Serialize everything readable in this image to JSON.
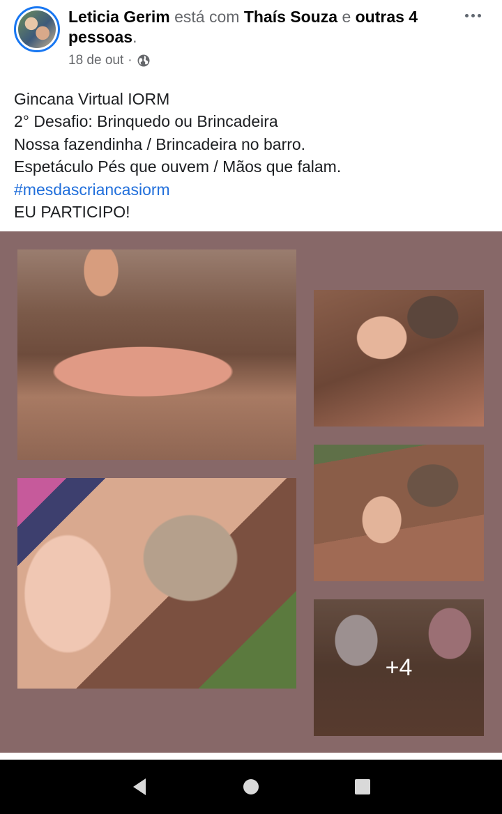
{
  "post": {
    "author": "Leticia Gerim",
    "with_text": "está com",
    "tagged": "Thaís Souza",
    "and_text": "e",
    "others": "outras 4 pessoas",
    "period": ".",
    "date": "18 de out",
    "separator": "·",
    "privacy_icon": "globe-icon",
    "text_lines": [
      "Gincana Virtual IORM",
      "2° Desafio: Brinquedo ou Brincadeira",
      "Nossa fazendinha / Brincadeira no barro.",
      "Espetáculo Pés que ouvem / Mãos que falam."
    ],
    "hashtag": "#mesdascriancasiorm",
    "closing": "EU PARTICIPO!"
  },
  "gallery": {
    "background": "#876868",
    "photo_count_visible": 5,
    "more_label": "+4"
  },
  "nav": {
    "back_icon": "back-triangle-icon",
    "home_icon": "home-circle-icon",
    "recents_icon": "recents-square-icon"
  },
  "colors": {
    "accent": "#1877f2",
    "hashtag": "#216fdb",
    "muted": "#65676b"
  }
}
